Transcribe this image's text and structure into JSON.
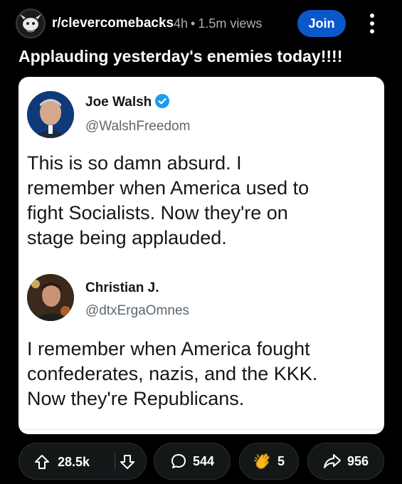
{
  "header": {
    "subreddit": "r/clevercomebacks",
    "age": "4h",
    "separator": "•",
    "views": "1.5m views",
    "join_label": "Join"
  },
  "post": {
    "title": "Applauding yesterday's enemies today!!!!"
  },
  "tweets": [
    {
      "name": "Joe Walsh",
      "handle": "@WalshFreedom",
      "verified": true,
      "lines": [
        "This is so damn absurd. I",
        "remember when America used to",
        "fight Socialists. Now they're on",
        "stage being applauded."
      ]
    },
    {
      "name": "Christian J.",
      "handle": "@dtxErgaOmnes",
      "verified": false,
      "lines": [
        "I remember when America fought",
        "confederates, nazis, and the KKK.",
        "Now they're Republicans."
      ]
    }
  ],
  "actions": {
    "upvotes": "28.5k",
    "comments": "544",
    "awards": "5",
    "shares": "956"
  },
  "icons": {
    "more": "more-vertical-icon",
    "upvote": "upvote-arrow-icon",
    "downvote": "downvote-arrow-icon",
    "comment": "comment-bubble-icon",
    "award": "clapping-hands-award-icon",
    "share": "share-arrow-icon",
    "verified": "verified-badge-icon"
  },
  "colors": {
    "background": "#000000",
    "join_button": "#0a58c9",
    "verified_badge": "#1d9bf0",
    "meta_text": "#a8aeb3",
    "pill_background": "#141718",
    "award_gold": "#f5b923"
  }
}
